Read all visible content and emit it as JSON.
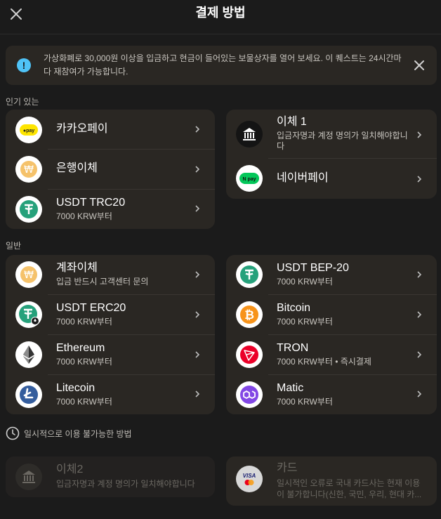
{
  "header": {
    "title": "결제 방법"
  },
  "notice": {
    "text": "가상화폐로 30,000원 이상을 입금하고 현금이 들어있는 보물상자를 열어 보세요. 이 퀘스트는 24시간마다 재참여가 가능합니다."
  },
  "popular": {
    "label": "인기 있는",
    "left": [
      {
        "name": "카카오페이",
        "sub": "",
        "icon": "kakaopay-icon"
      },
      {
        "name": "은행이체",
        "sub": "",
        "icon": "won-coin-icon"
      },
      {
        "name": "USDT TRC20",
        "sub": "7000 KRW부터",
        "icon": "tether-icon"
      }
    ],
    "right": [
      {
        "name": "이체 1",
        "sub": "입금자명과 계정 명의가 일치해야합니다",
        "icon": "bank-icon"
      },
      {
        "name": "네이버페이",
        "sub": "",
        "icon": "naverpay-icon"
      }
    ]
  },
  "general": {
    "label": "일반",
    "left": [
      {
        "name": "계좌이체",
        "sub": "입금 반드시 고객센터 문의",
        "icon": "won-coin-icon"
      },
      {
        "name": "USDT ERC20",
        "sub": "7000 KRW부터",
        "icon": "tether-erc20-icon"
      },
      {
        "name": "Ethereum",
        "sub": "7000 KRW부터",
        "icon": "ethereum-icon"
      },
      {
        "name": "Litecoin",
        "sub": "7000 KRW부터",
        "icon": "litecoin-icon"
      }
    ],
    "right": [
      {
        "name": "USDT BEP-20",
        "sub": "7000 KRW부터",
        "icon": "tether-icon"
      },
      {
        "name": "Bitcoin",
        "sub": "7000 KRW부터",
        "icon": "bitcoin-icon"
      },
      {
        "name": "TRON",
        "sub": "7000 KRW부터 • 즉시결제",
        "icon": "tron-icon"
      },
      {
        "name": "Matic",
        "sub": "7000 KRW부터",
        "icon": "matic-icon"
      }
    ]
  },
  "unavailable": {
    "label": "일시적으로 이용 불가능한 방법",
    "left": {
      "name": "이체2",
      "sub": "입금자명과 계정 명의가 일치해야합니다",
      "icon": "bank-icon"
    },
    "right": {
      "name": "카드",
      "sub": "일시적인 오류로 국내 카드사는 현재 이용이 불가합니다(신한, 국민, 우리, 현대 카...",
      "icon": "visa-mastercard-icon"
    }
  },
  "colors": {
    "background": "#1b1b1b",
    "card": "#2a2723",
    "tether": "#26a17b",
    "bitcoin": "#f7931a",
    "tron": "#eb0029",
    "matic": "#8247e5",
    "litecoin": "#345d9d",
    "kakao": "#fee500",
    "naver": "#03c75a",
    "info": "#4fc3f7"
  }
}
